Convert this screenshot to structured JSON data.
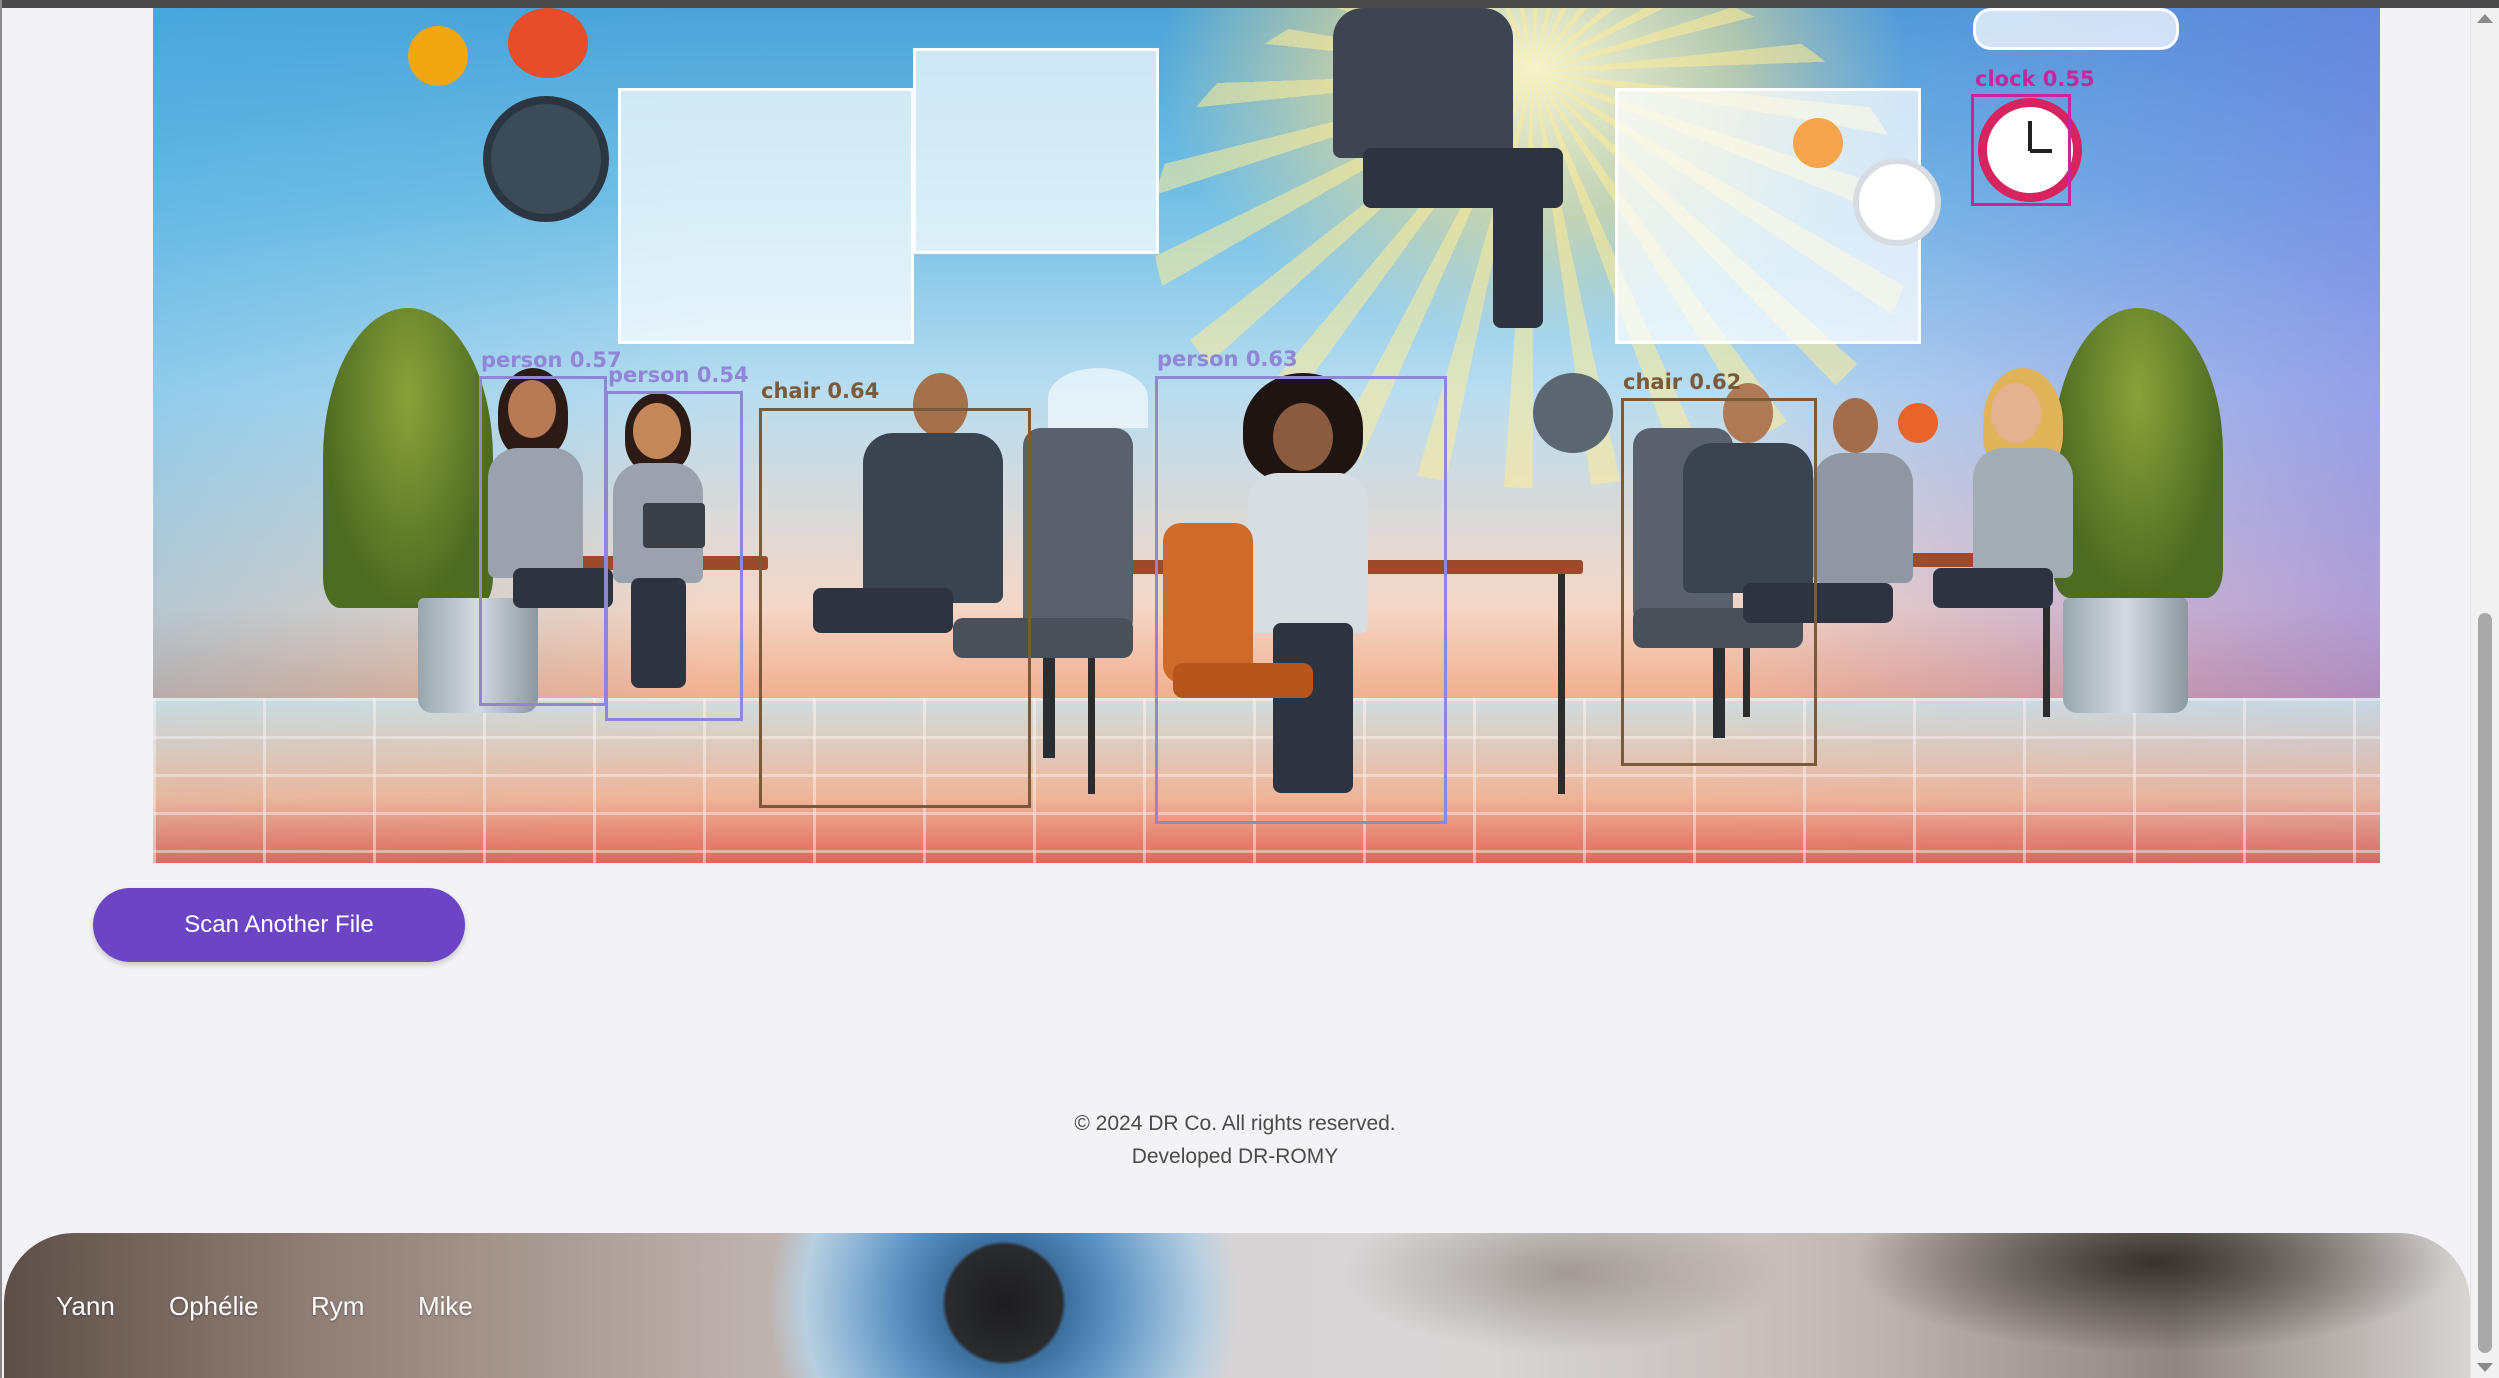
{
  "detections": [
    {
      "label": "person 0.57",
      "color": "#8f86d6"
    },
    {
      "label": "person 0.54",
      "color": "#8f86d6"
    },
    {
      "label": "chair 0.64",
      "color": "#7b5a3a"
    },
    {
      "label": "person 0.63",
      "color": "#8f86d6"
    },
    {
      "label": "chair 0.62",
      "color": "#7b5a3a"
    },
    {
      "label": "clock 0.55",
      "color": "#c2289a"
    }
  ],
  "actions": {
    "scan_button_label": "Scan Another File"
  },
  "footer": {
    "copyright": "© 2024 DR Co. All rights reserved.",
    "developer": "Developed DR-ROMY"
  },
  "team_nav": {
    "items": [
      {
        "label": "Yann"
      },
      {
        "label": "Ophélie"
      },
      {
        "label": "Rym"
      },
      {
        "label": "Mike"
      }
    ]
  },
  "theme": {
    "accent": "#6c45c4",
    "page_background": "#f3f2f7"
  }
}
